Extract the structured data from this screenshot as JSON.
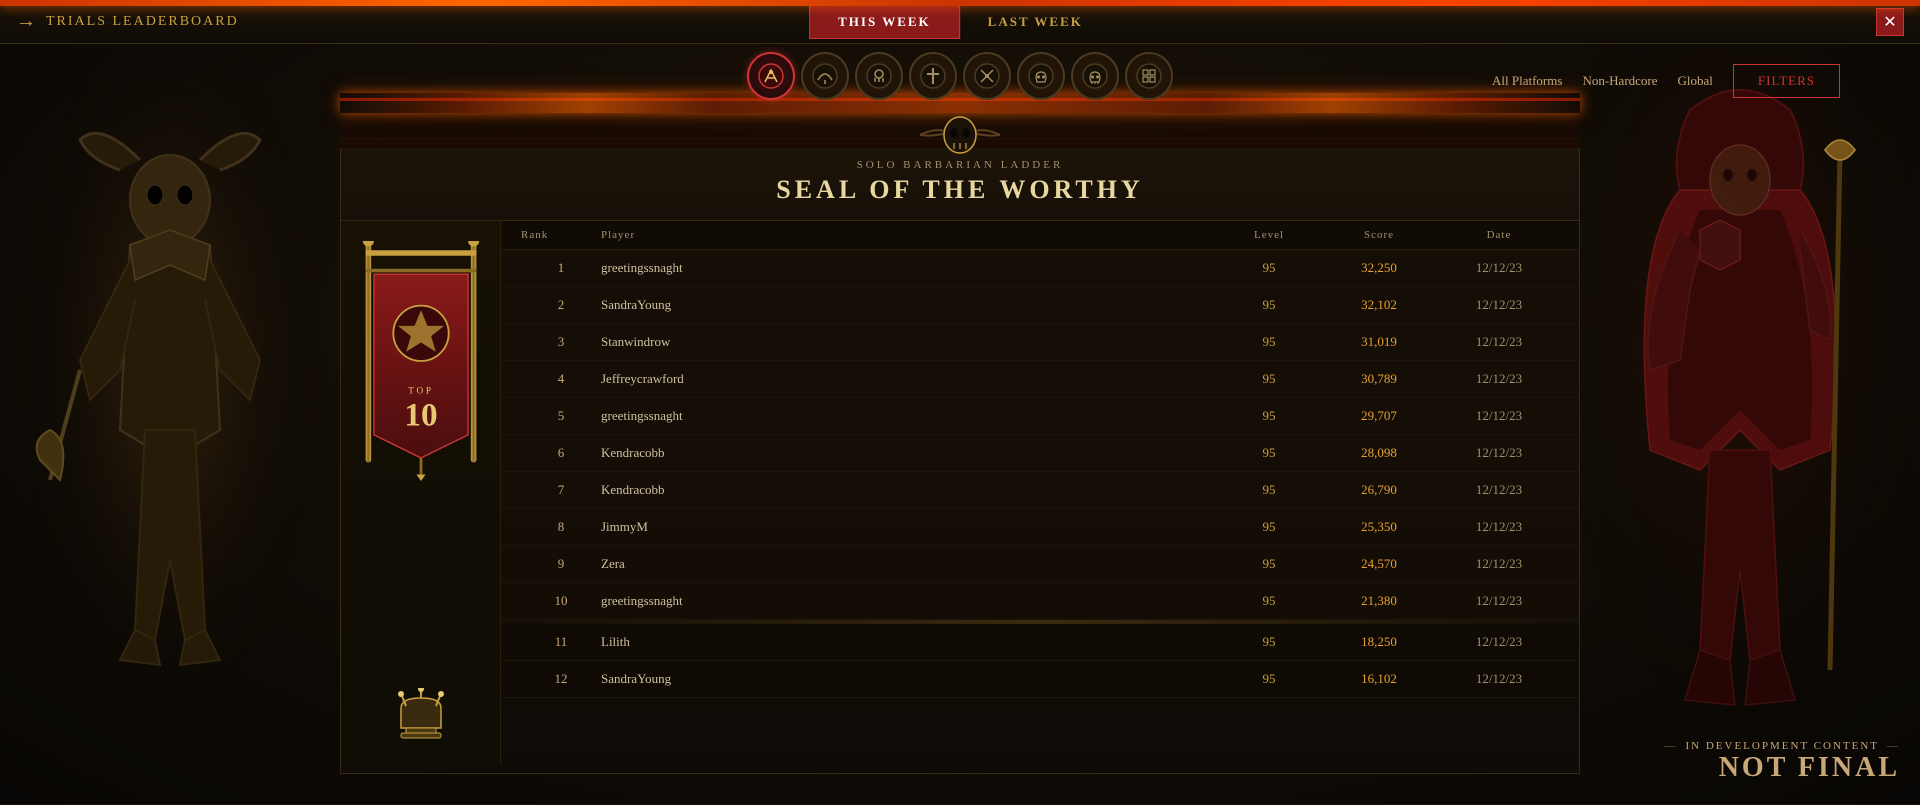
{
  "app": {
    "title": "TRIALS LEADERBOARD",
    "close_icon": "×"
  },
  "nav": {
    "back_arrow": "→",
    "tabs": [
      {
        "label": "THIS WEEK",
        "active": true
      },
      {
        "label": "LAST WEEK",
        "active": false
      }
    ]
  },
  "filters": {
    "platform": "All Platforms",
    "mode": "Non-Hardcore",
    "scope": "Global",
    "button_label": "Filters"
  },
  "class_icons": [
    {
      "name": "barbarian",
      "active": true
    },
    {
      "name": "druid",
      "active": false
    },
    {
      "name": "necromancer",
      "active": false
    },
    {
      "name": "paladin",
      "active": false
    },
    {
      "name": "rogue",
      "active": false
    },
    {
      "name": "skull1",
      "active": false
    },
    {
      "name": "skull2",
      "active": false
    },
    {
      "name": "grid",
      "active": false
    }
  ],
  "leaderboard": {
    "subtitle": "SOLO BARBARIAN LADDER",
    "title": "SEAL OF THE WORTHY",
    "trophy": {
      "top_text": "TOP",
      "number": "10"
    },
    "columns": {
      "rank": "Rank",
      "player": "Player",
      "level": "Level",
      "score": "Score",
      "date": "Date"
    },
    "rows": [
      {
        "rank": "1",
        "player": "greetingssnaght",
        "level": "95",
        "score": "32,250",
        "date": "12/12/23",
        "top10": true
      },
      {
        "rank": "2",
        "player": "SandraYoung",
        "level": "95",
        "score": "32,102",
        "date": "12/12/23",
        "top10": true
      },
      {
        "rank": "3",
        "player": "Stanwindrow",
        "level": "95",
        "score": "31,019",
        "date": "12/12/23",
        "top10": true
      },
      {
        "rank": "4",
        "player": "Jeffreycrawford",
        "level": "95",
        "score": "30,789",
        "date": "12/12/23",
        "top10": true
      },
      {
        "rank": "5",
        "player": "greetingssnaght",
        "level": "95",
        "score": "29,707",
        "date": "12/12/23",
        "top10": true
      },
      {
        "rank": "6",
        "player": "Kendracobb",
        "level": "95",
        "score": "28,098",
        "date": "12/12/23",
        "top10": true
      },
      {
        "rank": "7",
        "player": "Kendracobb",
        "level": "95",
        "score": "26,790",
        "date": "12/12/23",
        "top10": true
      },
      {
        "rank": "8",
        "player": "JimmyM",
        "level": "95",
        "score": "25,350",
        "date": "12/12/23",
        "top10": true
      },
      {
        "rank": "9",
        "player": "Zera",
        "level": "95",
        "score": "24,570",
        "date": "12/12/23",
        "top10": true
      },
      {
        "rank": "10",
        "player": "greetingssnaght",
        "level": "95",
        "score": "21,380",
        "date": "12/12/23",
        "top10": true
      },
      {
        "rank": "11",
        "player": "Lilith",
        "level": "95",
        "score": "18,250",
        "date": "12/12/23",
        "top10": false
      },
      {
        "rank": "12",
        "player": "SandraYoung",
        "level": "95",
        "score": "16,102",
        "date": "12/12/23",
        "top10": false
      }
    ]
  },
  "watermark": {
    "sub": "IN DEVELOPMENT CONTENT",
    "main": "NOT FINAL"
  },
  "colors": {
    "accent_red": "#cc3333",
    "accent_gold": "#c8a040",
    "score_orange": "#e8a030",
    "text_light": "#d0c0a0",
    "text_dim": "#a09070",
    "bg_dark": "#0f0c07"
  }
}
